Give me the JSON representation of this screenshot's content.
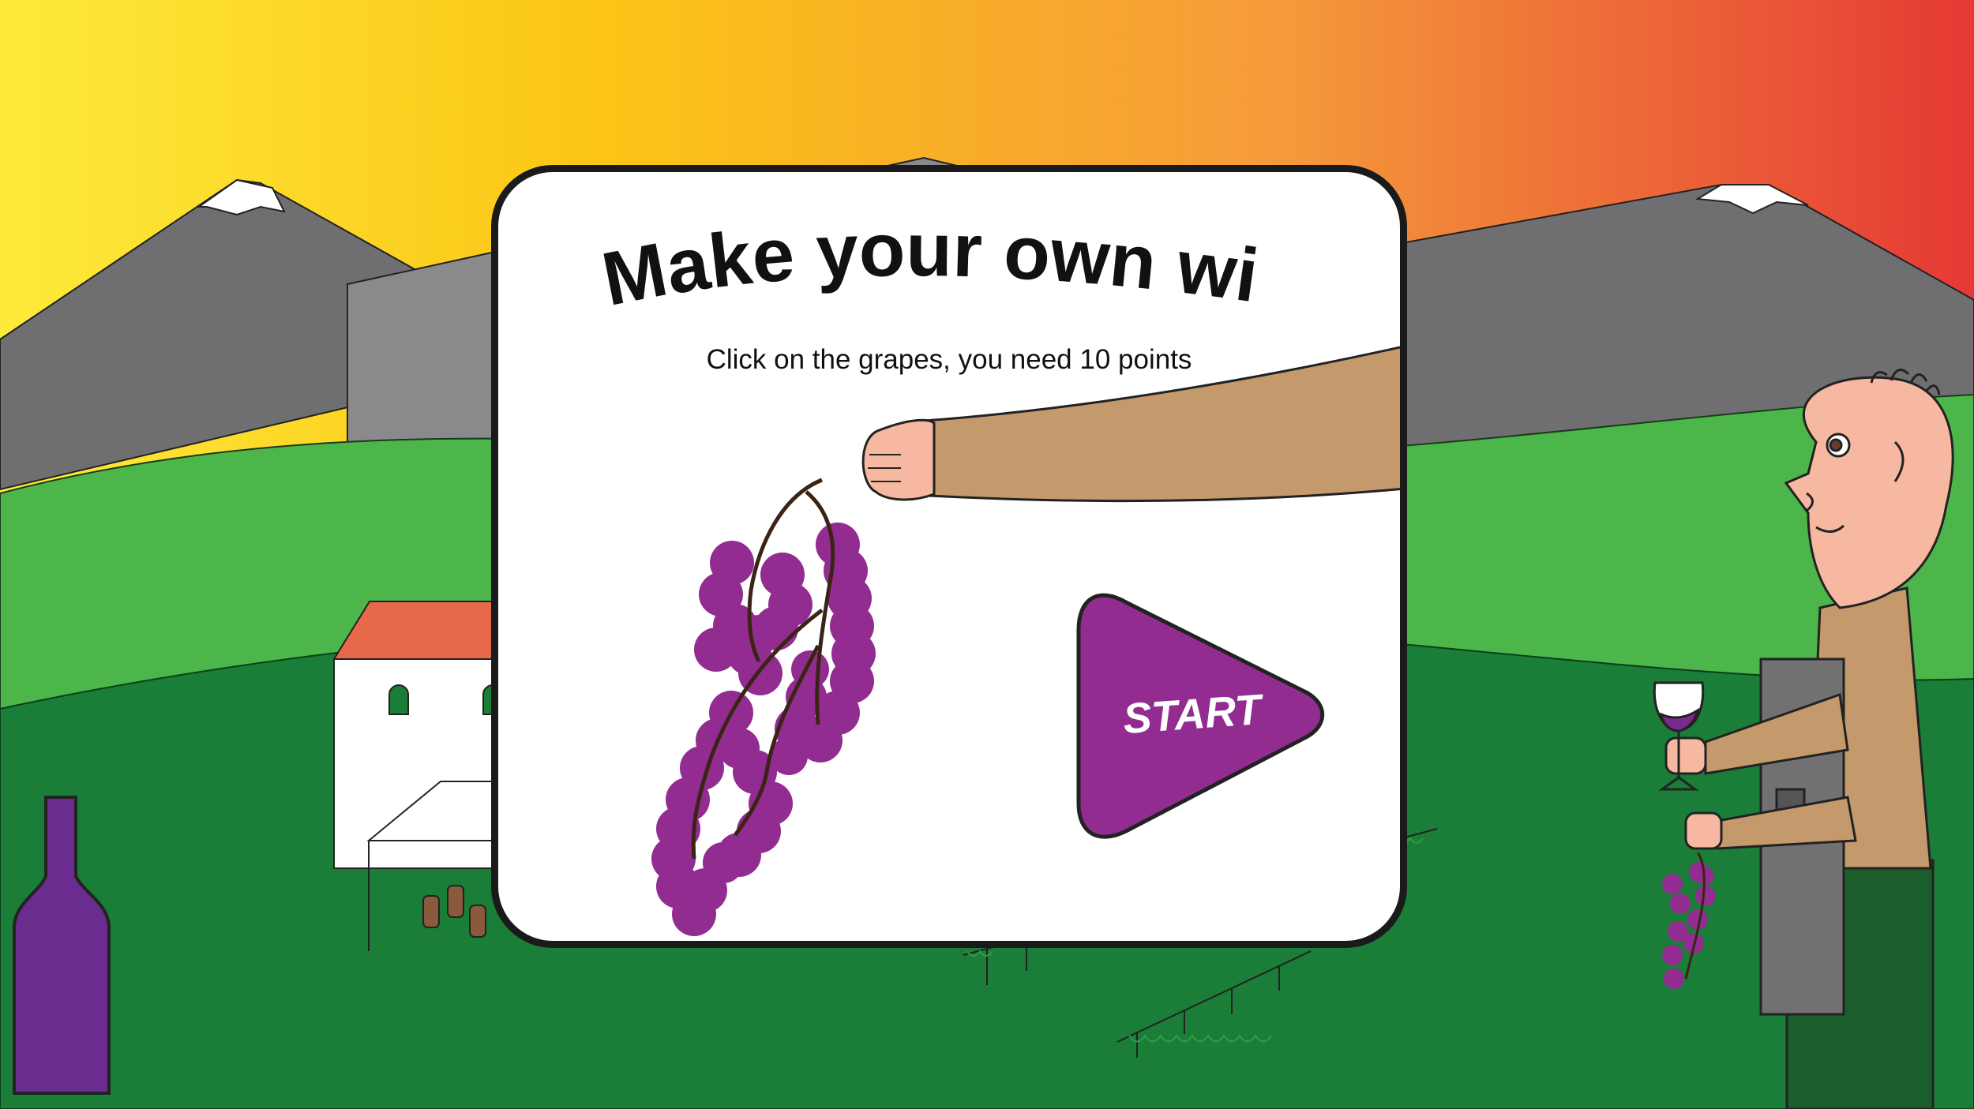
{
  "game": {
    "title": "Make your own wine",
    "instructions": "Click on the grapes, you need 10 points",
    "start_label": "START"
  },
  "colors": {
    "sky_left": "#fdeb3a",
    "sky_mid": "#fcc515",
    "sky_right": "#e53935",
    "mountain": "#6f6f71",
    "hill_light": "#4cb64a",
    "hill_dark": "#1a7d38",
    "grape_purple": "#922c91",
    "bottle_purple": "#6a2c8f",
    "skin": "#f6b8a0",
    "sleeve": "#c49a6c",
    "apron": "#717171",
    "roof": "#e8694a"
  },
  "icons": {
    "start": "play-triangle-icon",
    "bottle": "wine-bottle-icon",
    "glass": "wine-glass-icon"
  }
}
